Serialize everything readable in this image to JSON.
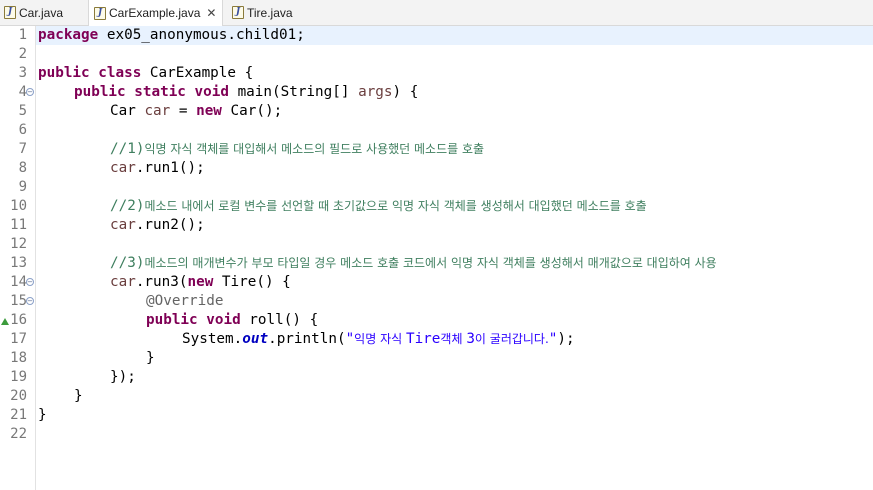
{
  "tabs": [
    {
      "label": "Car.java",
      "icon": "java-file-icon"
    },
    {
      "label": "CarExample.java",
      "icon": "java-file-icon",
      "active": true
    },
    {
      "label": "Tire.java",
      "icon": "java-file-icon"
    }
  ],
  "editor": {
    "line_numbers": [
      "1",
      "2",
      "3",
      "4",
      "5",
      "6",
      "7",
      "8",
      "9",
      "10",
      "11",
      "12",
      "13",
      "14",
      "15",
      "16",
      "17",
      "18",
      "19",
      "20",
      "21",
      "22"
    ],
    "code": {
      "l1_kw": "package",
      "l1_rest": " ex05_anonymous.child01;",
      "l3_kw1": "public",
      "l3_kw2": "class",
      "l3_rest": " CarExample {",
      "l4_kw1": "public",
      "l4_kw2": "static",
      "l4_kw3": "void",
      "l4_a": " main(String[] ",
      "l4_var": "args",
      "l4_b": ") {",
      "l5_a": "Car ",
      "l5_var": "car",
      "l5_b": " = ",
      "l5_kw": "new",
      "l5_c": " Car();",
      "l7_cm1": "//1)",
      "l7_cm2": "익명 자식 객체를 대입해서 메소드의 필드로 사용했던 메소드를 호출",
      "l8_var": "car",
      "l8_rest": ".run1();",
      "l10_cm1": "//2)",
      "l10_cm2": "메소드 내에서 로컬 변수를 선언할 때 초기값으로 익명 자식 객체를 생성해서 대입했던 메소드를 호출",
      "l11_var": "car",
      "l11_rest": ".run2();",
      "l13_cm1": "//3)",
      "l13_cm2": "메소드의 매개변수가 부모 타입일 경우 메소드 호출 코드에서 익명 자식 객체를 생성해서 매개값으로 대입하여 사용",
      "l14_var": "car",
      "l14_a": ".run3(",
      "l14_kw": "new",
      "l14_b": " Tire() {",
      "l15_an": "@Override",
      "l16_kw1": "public",
      "l16_kw2": "void",
      "l16_rest": " roll() {",
      "l17_a": "System.",
      "l17_fld": "out",
      "l17_b": ".println(",
      "l17_s1": "\"",
      "l17_sk1": "익명 자식 ",
      "l17_s2": "Tire",
      "l17_sk2": "객체 ",
      "l17_s3": "3",
      "l17_sk3": "이 굴러갑니다.",
      "l17_s4": "\"",
      "l17_c": ");",
      "l18": "}",
      "l19": "});",
      "l20": "}",
      "l21": "}"
    }
  },
  "colors": {
    "keyword": "#7f0055",
    "comment": "#3f7f5f",
    "string": "#2a00ff",
    "field": "#0000c0",
    "annotation": "#646464"
  }
}
